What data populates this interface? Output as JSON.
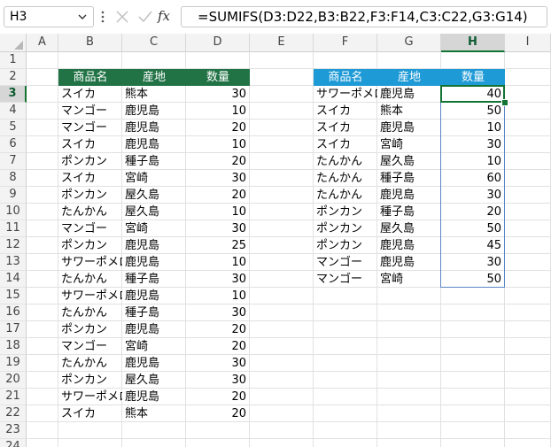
{
  "formula_bar": {
    "name_box": "H3",
    "fx_label": "fx",
    "formula": "=SUMIFS(D3:D22,B3:B22,F3:F14,C3:C22,G3:G14)"
  },
  "columns": [
    "A",
    "B",
    "C",
    "D",
    "E",
    "F",
    "G",
    "H",
    "I"
  ],
  "rows": [
    "1",
    "2",
    "3",
    "4",
    "5",
    "6",
    "7",
    "8",
    "9",
    "10",
    "11",
    "12",
    "13",
    "14",
    "15",
    "16",
    "17",
    "18",
    "19",
    "20",
    "21",
    "22",
    "23",
    "24"
  ],
  "selected_cell": {
    "column": "H",
    "row": "3"
  },
  "colors": {
    "left_header_bg": "#217346",
    "right_header_bg": "#1e9ad6",
    "selection_border": "#137333",
    "range_border": "#5b86c5"
  },
  "left_table": {
    "headers": [
      "商品名",
      "産地",
      "数量"
    ],
    "rows": [
      [
        "スイカ",
        "熊本",
        "30"
      ],
      [
        "マンゴー",
        "鹿児島",
        "10"
      ],
      [
        "マンゴー",
        "鹿児島",
        "20"
      ],
      [
        "スイカ",
        "鹿児島",
        "10"
      ],
      [
        "ポンカン",
        "種子島",
        "20"
      ],
      [
        "スイカ",
        "宮崎",
        "30"
      ],
      [
        "ポンカン",
        "屋久島",
        "20"
      ],
      [
        "たんかん",
        "屋久島",
        "10"
      ],
      [
        "マンゴー",
        "宮崎",
        "30"
      ],
      [
        "ポンカン",
        "鹿児島",
        "25"
      ],
      [
        "サワーポメロ",
        "鹿児島",
        "10"
      ],
      [
        "たんかん",
        "種子島",
        "30"
      ],
      [
        "サワーポメロ",
        "鹿児島",
        "10"
      ],
      [
        "たんかん",
        "種子島",
        "30"
      ],
      [
        "ポンカン",
        "鹿児島",
        "20"
      ],
      [
        "マンゴー",
        "宮崎",
        "20"
      ],
      [
        "たんかん",
        "鹿児島",
        "30"
      ],
      [
        "ポンカン",
        "屋久島",
        "30"
      ],
      [
        "サワーポメロ",
        "鹿児島",
        "20"
      ],
      [
        "スイカ",
        "熊本",
        "20"
      ]
    ]
  },
  "right_table": {
    "headers": [
      "商品名",
      "産地",
      "数量"
    ],
    "rows": [
      [
        "サワーポメロ",
        "鹿児島",
        "40"
      ],
      [
        "スイカ",
        "熊本",
        "50"
      ],
      [
        "スイカ",
        "鹿児島",
        "10"
      ],
      [
        "スイカ",
        "宮崎",
        "30"
      ],
      [
        "たんかん",
        "屋久島",
        "10"
      ],
      [
        "たんかん",
        "種子島",
        "60"
      ],
      [
        "たんかん",
        "鹿児島",
        "30"
      ],
      [
        "ポンカン",
        "種子島",
        "20"
      ],
      [
        "ポンカン",
        "屋久島",
        "50"
      ],
      [
        "ポンカン",
        "鹿児島",
        "45"
      ],
      [
        "マンゴー",
        "鹿児島",
        "30"
      ],
      [
        "マンゴー",
        "宮崎",
        "50"
      ]
    ]
  }
}
